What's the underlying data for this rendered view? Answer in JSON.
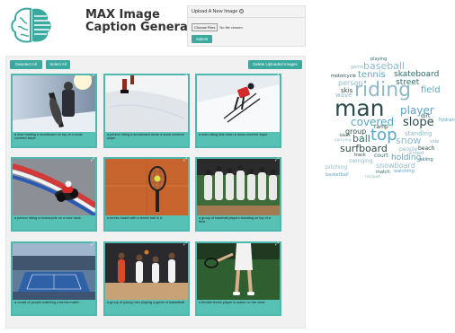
{
  "app": {
    "title_line1": "MAX Image",
    "title_line2": "Caption Generator"
  },
  "upload": {
    "header": "Upload A New Image",
    "help_icon": "question-circle",
    "choose_label": "Choose Files",
    "no_file_label": "No file chosen",
    "submit_label": "Submit"
  },
  "toolbar": {
    "deselect_label": "Deselect All",
    "select_label": "Select All",
    "delete_label": "Delete Uploaded Images"
  },
  "cards": [
    {
      "caption": "a man holding a snowboard on top of a snow covered slope ."
    },
    {
      "caption": "a person riding a snowboard down a snow covered slope ."
    },
    {
      "caption": "a man riding skis down a snow covered slope ."
    },
    {
      "caption": "a person riding a motorcycle on a race track ."
    },
    {
      "caption": "a tennis racket with a tennis ball in it ."
    },
    {
      "caption": "a group of baseball players standing on top of a field ."
    },
    {
      "caption": "a crowd of people watching a tennis match ."
    },
    {
      "caption": "a group of young men playing a game of basketball ."
    },
    {
      "caption": "a female tennis player in action on the court ."
    }
  ],
  "wordcloud": [
    {
      "text": "playing",
      "color": "#2d6b6b"
    },
    {
      "text": "baseball",
      "color": "#8fb9c9"
    },
    {
      "text": "game",
      "color": "#8fb9c9"
    },
    {
      "text": "motorcycle",
      "color": "#2d4b4b"
    },
    {
      "text": "tennis",
      "color": "#5aa7c7"
    },
    {
      "text": "skateboard",
      "color": "#2d6b6b"
    },
    {
      "text": "person",
      "color": "#8fb9c9"
    },
    {
      "text": "street",
      "color": "#2d6b6b"
    },
    {
      "text": "riding",
      "color": "#8fb9c9"
    },
    {
      "text": "skis",
      "color": "#2d4b4b"
    },
    {
      "text": "field",
      "color": "#5aa7c7"
    },
    {
      "text": "wave",
      "color": "#8fb9c9"
    },
    {
      "text": "player",
      "color": "#5aa7c7"
    },
    {
      "text": "man",
      "color": "#2d4b4b"
    },
    {
      "text": "covered",
      "color": "#5aa7c7"
    },
    {
      "text": "slope",
      "color": "#2d4b4b"
    },
    {
      "text": "top",
      "color": "#5aa7c7"
    },
    {
      "text": "group",
      "color": "#2d4b4b"
    },
    {
      "text": "ball",
      "color": "#2d6b6b"
    },
    {
      "text": "snow",
      "color": "#8fb9c9"
    },
    {
      "text": "standing",
      "color": "#8fb9c9"
    },
    {
      "text": "surfboard",
      "color": "#2d4b4b"
    },
    {
      "text": "holding",
      "color": "#5aa7c7"
    },
    {
      "text": "beach",
      "color": "#2d4b4b"
    },
    {
      "text": "court",
      "color": "#2d6b6b"
    },
    {
      "text": "pitching",
      "color": "#8fb9c9"
    },
    {
      "text": "snowboard",
      "color": "#8fb9c9"
    },
    {
      "text": "basketball",
      "color": "#5aa7c7"
    },
    {
      "text": "people",
      "color": "#8fb9c9"
    },
    {
      "text": "crowd",
      "color": "#8fb9c9"
    },
    {
      "text": "swinging",
      "color": "#8fb9c9"
    },
    {
      "text": "match",
      "color": "#2d6b6b"
    },
    {
      "text": "watching",
      "color": "#5aa7c7"
    },
    {
      "text": "racquet",
      "color": "#8fb9c9"
    },
    {
      "text": "side",
      "color": "#8fb9c9"
    },
    {
      "text": "ramp",
      "color": "#2d4b4b"
    },
    {
      "text": "hydrant",
      "color": "#5aa7c7"
    },
    {
      "text": "skiing",
      "color": "#2d6b6b"
    },
    {
      "text": "dirt",
      "color": "#2d4b4b"
    },
    {
      "text": "bikes",
      "color": "#2d4b4b"
    },
    {
      "text": "carrying",
      "color": "#8fb9c9"
    },
    {
      "text": "track",
      "color": "#2d4b4b"
    }
  ],
  "colors": {
    "accent": "#3aa99f",
    "card": "#4fb8ae"
  }
}
